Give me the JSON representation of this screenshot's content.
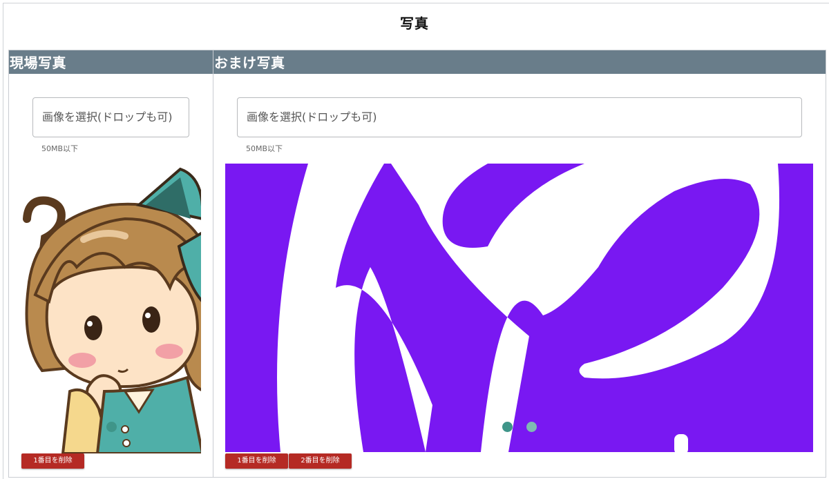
{
  "page": {
    "title": "写真"
  },
  "panels": {
    "left": {
      "header": "現場写真",
      "file_input_placeholder": "画像を選択(ドロップも可)",
      "size_note": "50MB以下",
      "image_icon": "girl-thinking-illustration",
      "carousel": {
        "total": 1,
        "current": 1
      },
      "delete_buttons": [
        "1番目を削除"
      ]
    },
    "right": {
      "header": "おまけ写真",
      "file_input_placeholder": "画像を選択(ドロップも可)",
      "size_note": "50MB以下",
      "image_icon": "purple-logo-image",
      "carousel": {
        "total": 2,
        "current": 1
      },
      "delete_buttons": [
        "1番目を削除",
        "2番目を削除"
      ]
    }
  },
  "colors": {
    "header_bg": "#697d8a",
    "delete_button": "#b52a24",
    "logo_bg": "#7918f2",
    "dot_active": "#3f9589",
    "dot_inactive": "#7fb9b3"
  }
}
